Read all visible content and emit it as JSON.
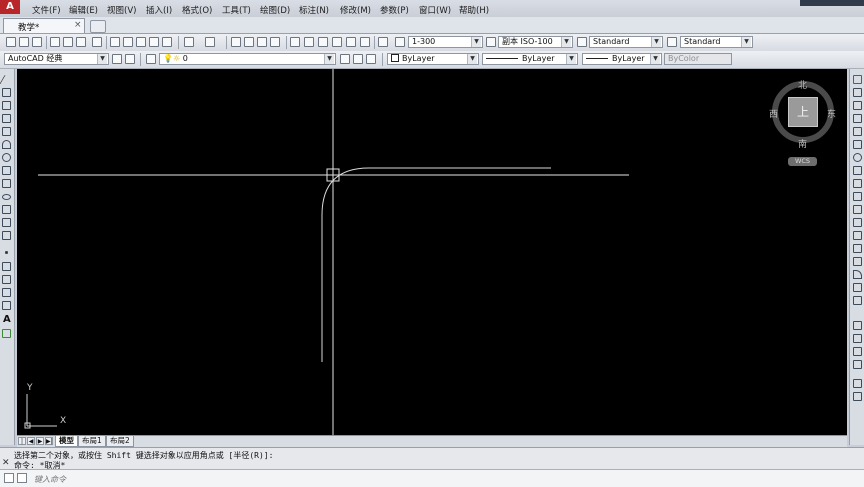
{
  "menubar": {
    "items": [
      "文件(F)",
      "编辑(E)",
      "视图(V)",
      "插入(I)",
      "格式(O)",
      "工具(T)",
      "绘图(D)",
      "标注(N)",
      "修改(M)",
      "参数(P)",
      "窗口(W)",
      "帮助(H)"
    ]
  },
  "tabs": {
    "document": "教学*",
    "close": "×"
  },
  "toolbar1": {
    "scale": "1-300",
    "dim_style": "副本 ISO-100",
    "text_style": "Standard",
    "table_style": "Standard"
  },
  "toolbar2": {
    "workspace": "AutoCAD 经典",
    "layer": "0",
    "color": "ByLayer",
    "linetype": "ByLayer",
    "lineweight": "ByLayer",
    "plotstyle": "ByColor"
  },
  "viewcube": {
    "north": "北",
    "south": "南",
    "east": "东",
    "west": "西",
    "face": "上",
    "wcs": "WCS"
  },
  "ucs": {
    "x": "X",
    "y": "Y"
  },
  "layout_tabs": {
    "model": "模型",
    "layout1": "布局1",
    "layout2": "布局2"
  },
  "command": {
    "line1": "选择第二个对象，或按住 Shift 键选择对象以应用角点或 [半径(R)]:",
    "line2": "命令: *取消*",
    "placeholder": "键入命令"
  },
  "colors": {
    "canvas": "#000000",
    "drawing": "#e6e6e6"
  }
}
